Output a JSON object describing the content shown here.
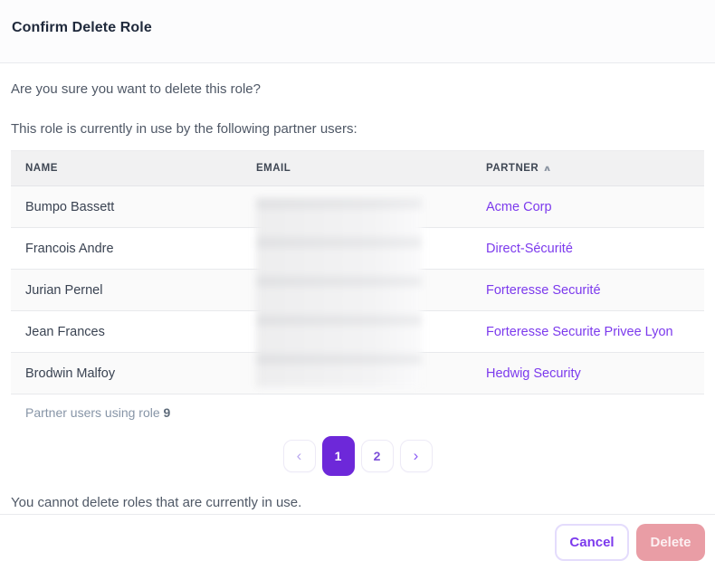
{
  "dialog": {
    "title": "Confirm Delete Role"
  },
  "messages": {
    "confirm_question": "Are you sure you want to delete this role?",
    "in_use_intro": "This role is currently in use by the following partner users:",
    "cannot_delete": "You cannot delete roles that are currently in use."
  },
  "table": {
    "columns": [
      {
        "label": "NAME",
        "sorted": null
      },
      {
        "label": "EMAIL",
        "sorted": null
      },
      {
        "label": "PARTNER",
        "sorted": "asc"
      }
    ],
    "rows": [
      {
        "name": "Bumpo Bassett",
        "email_redacted": true,
        "partner": "Acme Corp"
      },
      {
        "name": "Francois Andre",
        "email_redacted": true,
        "partner": "Direct-Sécurité"
      },
      {
        "name": "Jurian Pernel",
        "email_redacted": true,
        "partner": "Forteresse Securité"
      },
      {
        "name": "Jean Frances",
        "email_redacted": true,
        "partner": "Forteresse Securite Privee Lyon"
      },
      {
        "name": "Brodwin Malfoy",
        "email_redacted": true,
        "partner": "Hedwig Security"
      }
    ],
    "footer": {
      "label": "Partner users using role",
      "count": "9"
    }
  },
  "pagination": {
    "pages": [
      "1",
      "2"
    ],
    "active_page": "1"
  },
  "icons": {
    "sort_asc": "∧",
    "prev_chevron": "‹",
    "next_chevron": "›"
  },
  "buttons": {
    "cancel": "Cancel",
    "delete": "Delete"
  },
  "colors": {
    "accent_purple": "#7c3aed",
    "active_page_purple": "#6d28d9",
    "delete_pink": "#e99da5",
    "title_navy": "#202a3c",
    "body_gray": "#4f5866",
    "table_header_bg": "#f1f1f2",
    "note_gray": "#8795a7"
  }
}
